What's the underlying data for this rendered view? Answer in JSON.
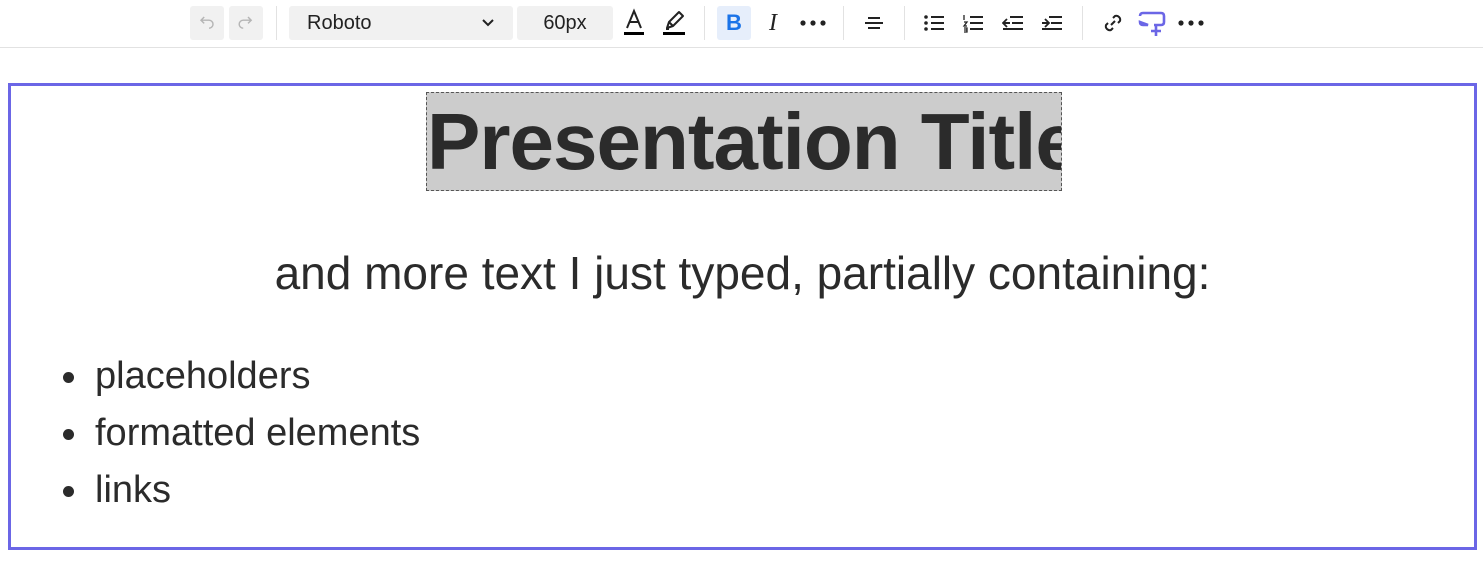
{
  "toolbar": {
    "font_family": "Roboto",
    "font_size": "60px",
    "bold_label": "B",
    "italic_label": "I",
    "text_color": "#000000",
    "accent_color": "#6b66e6",
    "active_color": "#1a73e8",
    "icons": [
      "undo-icon",
      "redo-icon",
      "font-color-icon",
      "highlight-icon",
      "bold-icon",
      "italic-icon",
      "more-icon",
      "align-center-icon",
      "bulleted-list-icon",
      "numbered-list-icon",
      "outdent-icon",
      "indent-icon",
      "link-icon",
      "add-comment-icon",
      "more-icon"
    ]
  },
  "slide": {
    "title": "Presentation Title",
    "subtitle": "and more text I just typed, partially containing:",
    "bullets": [
      "placeholders",
      "formatted elements",
      "links"
    ]
  }
}
